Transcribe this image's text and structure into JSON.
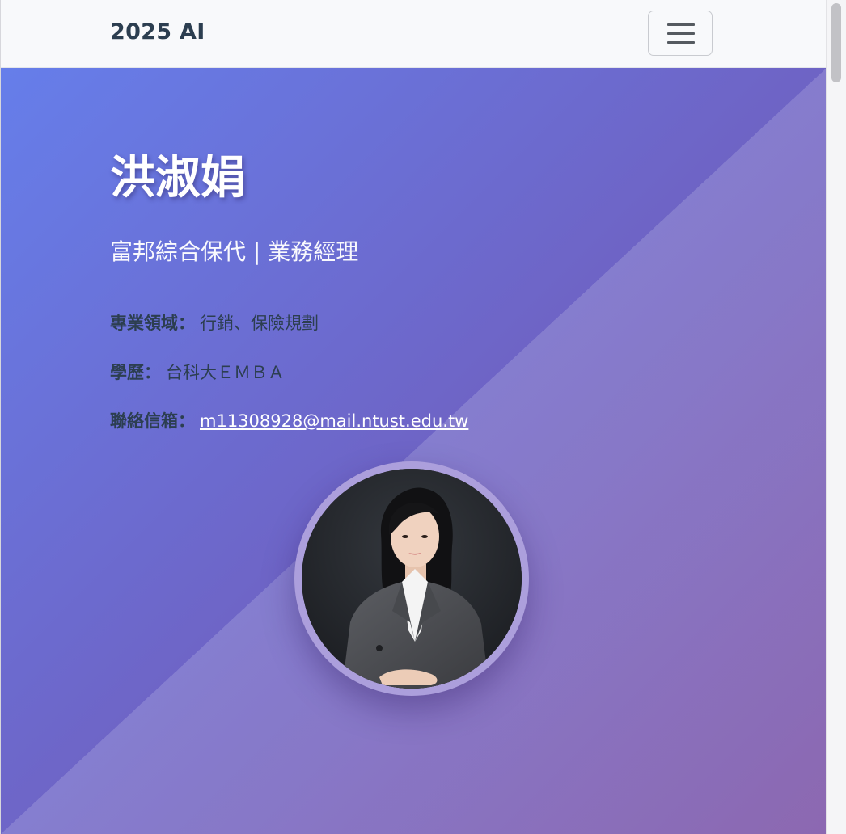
{
  "navbar": {
    "brand": "2025 AI",
    "toggler_icon": "hamburger-icon"
  },
  "profile": {
    "name": "洪淑娟",
    "subtitle": "富邦綜合保代 | 業務經理",
    "fields": {
      "expertise_label": "專業領域：",
      "expertise_value": "行銷、保險規劃",
      "education_label": "學歷：",
      "education_value": "台科大ＥＭＢＡ",
      "email_label": "聯絡信箱：",
      "email_value": "m11308928@mail.ntust.edu.tw"
    },
    "avatar": "profile-photo"
  },
  "colors": {
    "gradient_start": "#667eea",
    "gradient_end": "#764ba2",
    "text_dark": "#2c3e50",
    "navbar_bg": "#f8f9fb"
  }
}
